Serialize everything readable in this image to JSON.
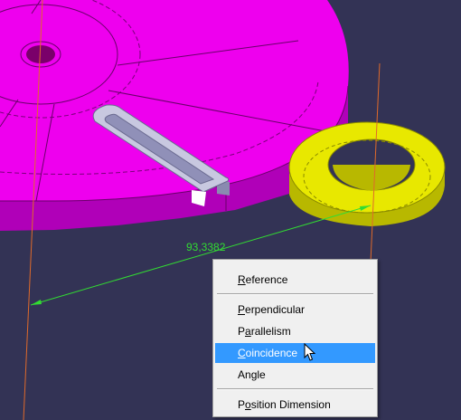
{
  "viewer": {
    "background": "#333355",
    "colors": {
      "disc": "#ee00ee",
      "disc_side": "#b000b8",
      "ring": "#e8e800",
      "ring_side": "#b8b800",
      "slot": "#c8c8e0",
      "axis_line": "#e06a2a",
      "dimension": "#32dc32"
    },
    "dimension_value": "93,3382"
  },
  "context_menu": {
    "items": [
      {
        "name": "menu-item-reference",
        "prefix": "",
        "mnemonic": "R",
        "rest": "eference"
      },
      {
        "name": "menu-item-perpendicular",
        "prefix": "",
        "mnemonic": "P",
        "rest": "erpendicular"
      },
      {
        "name": "menu-item-parallelism",
        "prefix": "P",
        "mnemonic": "a",
        "rest": "rallelism"
      },
      {
        "name": "menu-item-coincidence",
        "prefix": "",
        "mnemonic": "C",
        "rest": "oincidence"
      },
      {
        "name": "menu-item-angle",
        "prefix": "An",
        "mnemonic": "g",
        "rest": "le"
      },
      {
        "name": "menu-item-position-dimension",
        "prefix": "P",
        "mnemonic": "o",
        "rest": "sition Dimension"
      }
    ],
    "selected_item": "Coincidence",
    "highlight_color": "#3399ff"
  }
}
